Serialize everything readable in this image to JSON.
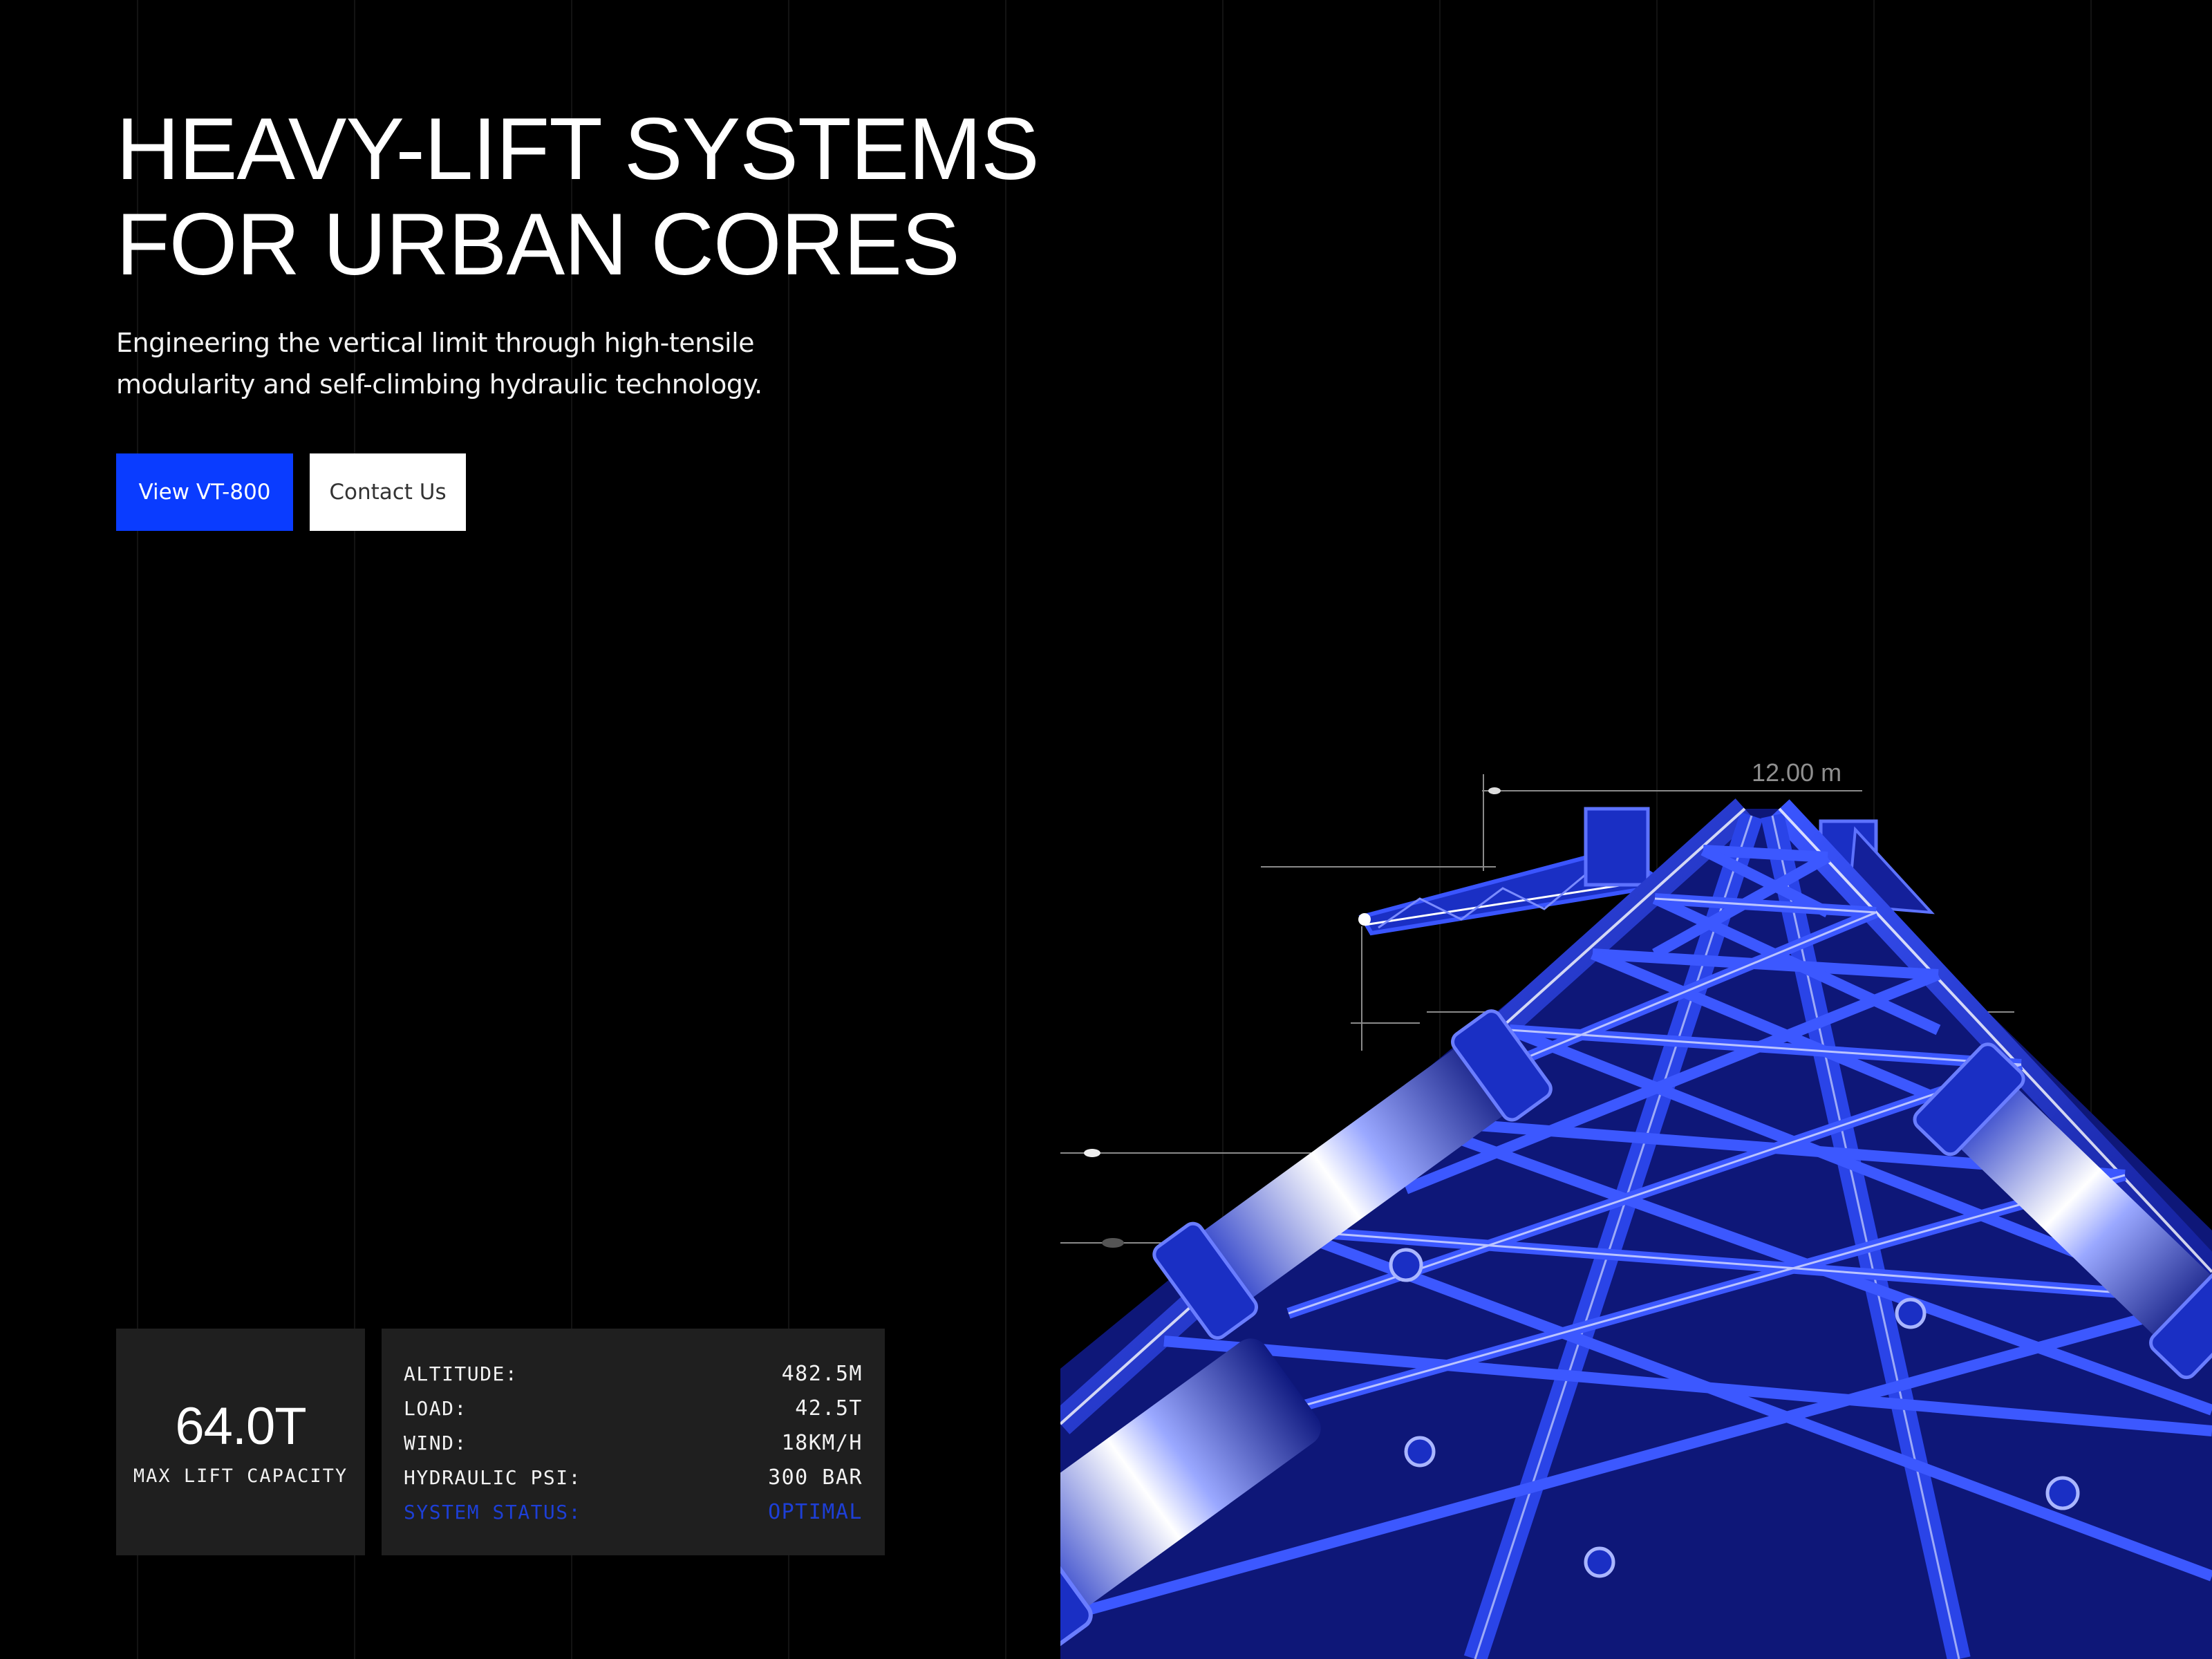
{
  "hero": {
    "title_line1": "HEAVY-LIFT SYSTEMS",
    "title_line2": "FOR URBAN CORES",
    "subtitle_line1": "Engineering the vertical limit through high-tensile",
    "subtitle_line2": "modularity and self-climbing hydraulic technology."
  },
  "buttons": {
    "primary_label": "View VT-800",
    "secondary_label": "Contact Us"
  },
  "stat": {
    "value": "64.0T",
    "label": "MAX LIFT CAPACITY"
  },
  "telemetry": [
    {
      "label": "ALTITUDE:",
      "value": "482.5M"
    },
    {
      "label": "LOAD:",
      "value": "42.5T"
    },
    {
      "label": "WIND:",
      "value": "18KM/H"
    },
    {
      "label": "HYDRAULIC PSI:",
      "value": "300 BAR"
    },
    {
      "label": "SYSTEM STATUS:",
      "value": "OPTIMAL"
    }
  ],
  "illustration": {
    "dimension_label": "12.00 m"
  },
  "colors": {
    "accent": "#0a3cff",
    "status": "#1d3fd6",
    "panel": "#1f1f1f",
    "crane_blue": "#1a2fc4"
  }
}
